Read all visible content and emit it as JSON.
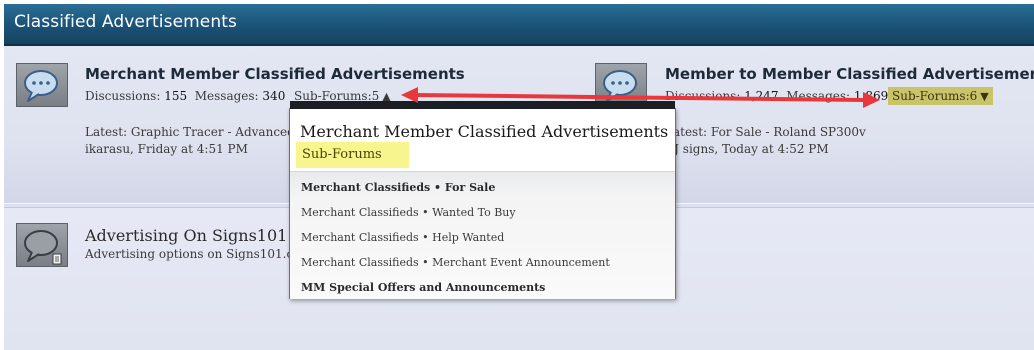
{
  "header": {
    "title": "Classified Advertisements"
  },
  "forums": [
    {
      "title": "Merchant Member Classified Advertisements",
      "discussions_label": "Discussions:",
      "discussions": "155",
      "messages_label": "Messages:",
      "messages": "340",
      "subforums_label": "Sub-Forums:5",
      "latest_label": "Latest:",
      "latest_title": "Graphic Tracer - Advanced",
      "latest_meta": "ikarasu, Friday at 4:51 PM"
    },
    {
      "title": "Member to Member Classified Advertisements",
      "discussions_label": "Discussions:",
      "discussions": "1,247",
      "messages_label": "Messages:",
      "messages": "1,869",
      "subforums_label": "Sub-Forums:6",
      "latest_label": "Latest:",
      "latest_title": "For Sale - Roland SP300v",
      "latest_meta": "CJ signs, Today at 4:52 PM"
    },
    {
      "title": "Advertising On Signs101",
      "description": "Advertising options on Signs101.com"
    }
  ],
  "popup": {
    "title": "Merchant Member Classified Advertisements",
    "subtitle": "Sub-Forums",
    "items": [
      "Merchant Classifieds • For Sale",
      "Merchant Classifieds • Wanted To Buy",
      "Merchant Classifieds • Help Wanted",
      "Merchant Classifieds • Merchant Event Announcement",
      "MM Special Offers and Announcements"
    ]
  },
  "colors": {
    "header": "#1b5277",
    "annotation_arrow": "#e8383b",
    "highlight_subforums": "#c9c46a",
    "popup_subtitle_highlight": "#f6f58e"
  },
  "icons": {
    "forum_icon": "chat-bubble-icon",
    "link_forum_icon": "chat-bubble-document-icon",
    "chevron_up": "chevron-up-icon",
    "chevron_down": "chevron-down-icon"
  }
}
